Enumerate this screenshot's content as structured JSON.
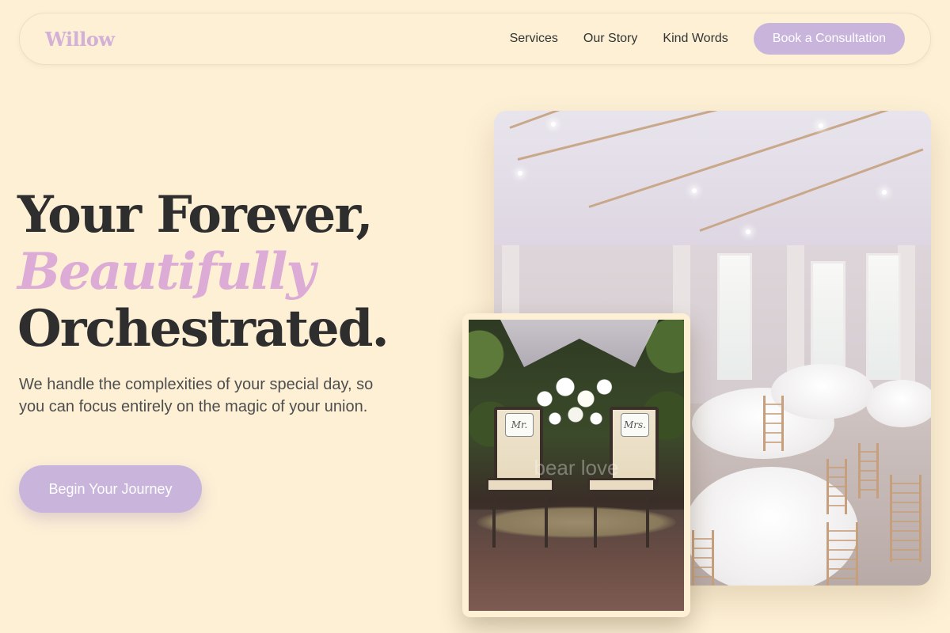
{
  "brand": {
    "logo": "Willow"
  },
  "nav": {
    "links": [
      "Services",
      "Our Story",
      "Kind Words"
    ],
    "cta": "Book a Consultation"
  },
  "hero": {
    "title_line1": "Your Forever,",
    "title_accent": "Beautifully",
    "title_line3": "Orchestrated.",
    "subtitle": "We handle the complexities of your special day, so you can focus entirely on the magic of your union.",
    "cta": "Begin Your Journey"
  },
  "images": {
    "venue": {
      "icon": "reception-hall-photo"
    },
    "chairs": {
      "icon": "mr-mrs-chairs-photo",
      "sign_left": "Mr.",
      "sign_right": "Mrs.",
      "watermark": "bear love"
    }
  },
  "colors": {
    "background": "#fdf0d5",
    "accent": "#c9b4db",
    "accent_text": "#dcabd6",
    "heading": "#2f2e2e"
  }
}
